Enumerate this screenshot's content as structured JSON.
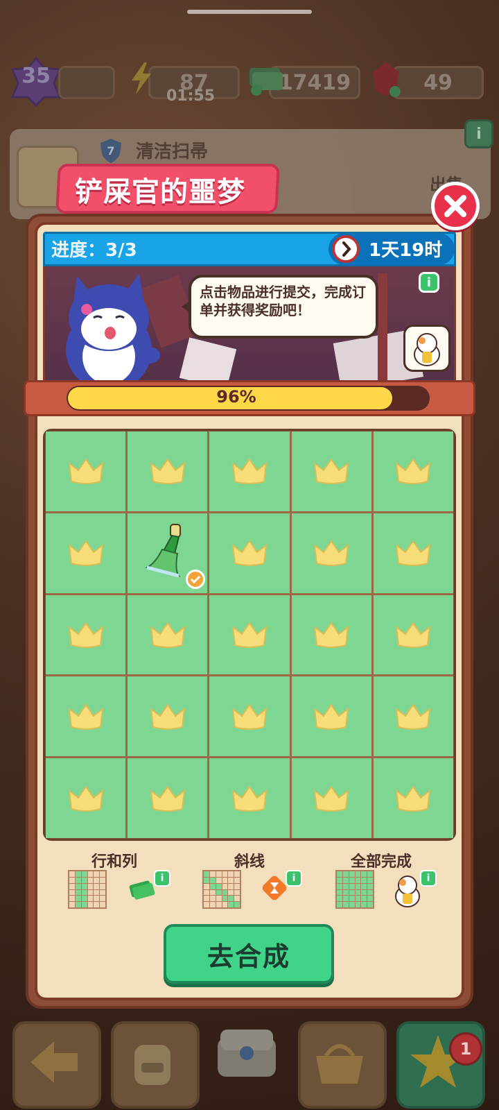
{
  "status": {
    "level": "35",
    "energy": "87",
    "energy_timer": "01:55",
    "cash": "17419",
    "gems": "49"
  },
  "background_item": {
    "shield_level": "7",
    "name": "清洁扫帚",
    "sell_label": "出售"
  },
  "modal": {
    "title": "铲屎官的噩梦",
    "progress_label": "进度：",
    "progress_value": "3/3",
    "timer": "1天19时",
    "dialog": "点击物品进行提交，完成订单并获得奖励吧！",
    "completion_percent_label": "96%",
    "completion_fraction": 0.96,
    "grid": {
      "rows": 5,
      "cols": 5,
      "filled_cell": {
        "row": 2,
        "col": 2,
        "item": "broom-icon",
        "checked": true
      }
    },
    "rewards": [
      {
        "label": "行和列",
        "icon": "cash-bundle-icon"
      },
      {
        "label": "斜线",
        "icon": "hourglass-coin-icon"
      },
      {
        "label": "全部完成",
        "icon": "lucky-cat-icon"
      }
    ],
    "go_button": "去合成"
  },
  "bottom_nav": {
    "badge_count": "1"
  },
  "colors": {
    "title_pink": "#f24f6a",
    "header_blue": "#1aa4e8",
    "cell_green": "#7ed693",
    "progress_yellow": "#ffd84a",
    "button_green": "#3fd48a",
    "close_red": "#e8304a"
  }
}
